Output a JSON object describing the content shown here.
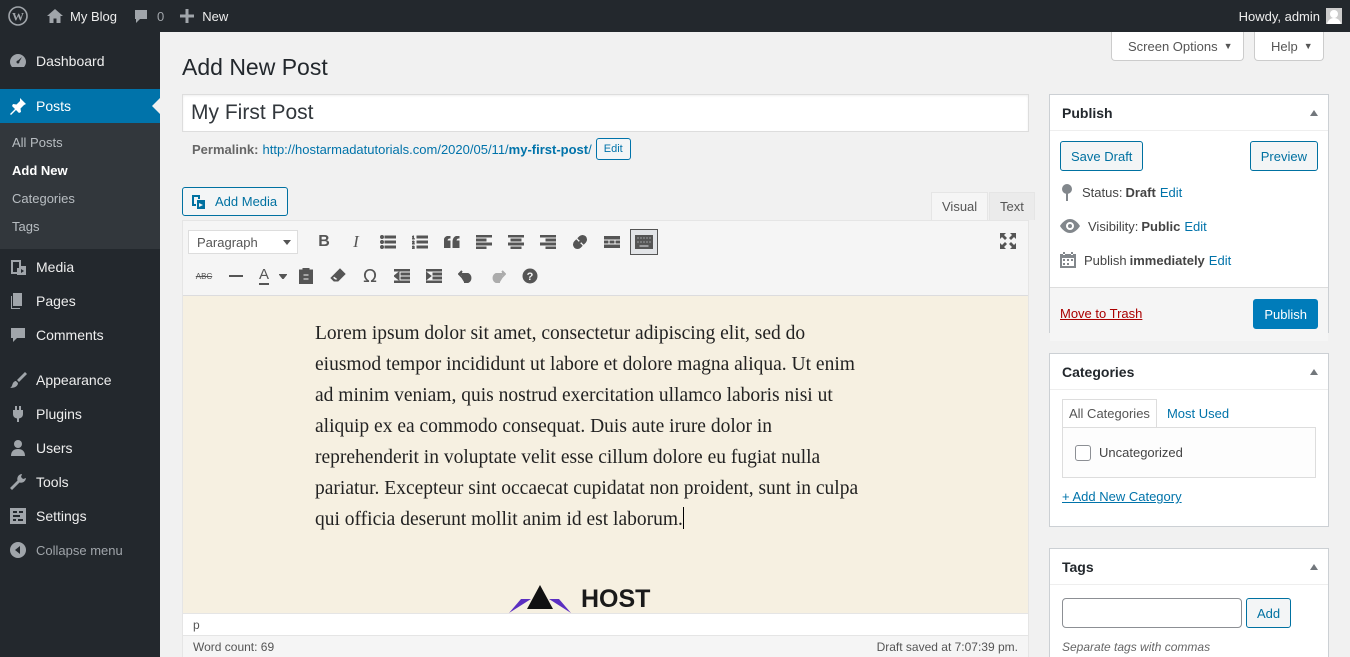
{
  "admin_bar": {
    "site_name": "My Blog",
    "comments_count": "0",
    "new_label": "New",
    "greeting": "Howdy, admin"
  },
  "menu": {
    "dashboard": "Dashboard",
    "posts": "Posts",
    "posts_sub": [
      "All Posts",
      "Add New",
      "Categories",
      "Tags"
    ],
    "media": "Media",
    "pages": "Pages",
    "comments": "Comments",
    "appearance": "Appearance",
    "plugins": "Plugins",
    "users": "Users",
    "tools": "Tools",
    "settings": "Settings",
    "collapse": "Collapse menu"
  },
  "screen_options": "Screen Options",
  "help": "Help",
  "page_title": "Add New Post",
  "post": {
    "title": "My First Post",
    "permalink_label": "Permalink:",
    "permalink_url": "http://hostarmadatutorials.com/2020/05/11/",
    "permalink_slug": "my-first-post",
    "permalink_tail": "/",
    "edit_label": "Edit"
  },
  "editor": {
    "add_media": "Add Media",
    "tab_visual": "Visual",
    "tab_text": "Text",
    "format": "Paragraph",
    "content": "Lorem ipsum dolor sit amet, consectetur adipiscing elit, sed do eiusmod tempor incididunt ut labore et dolore magna aliqua. Ut enim ad minim veniam, quis nostrud exercitation ullamco laboris nisi ut aliquip ex ea commodo consequat. Duis aute irure dolor in reprehenderit in voluptate velit esse cillum dolore eu fugiat nulla pariatur. Excepteur sint occaecat cupidatat non proident, sunt in culpa qui officia deserunt mollit anim id est laborum.",
    "logo_text": "HOST",
    "path": "p",
    "word_count": "Word count: 69",
    "draft_saved": "Draft saved at 7:07:39 pm."
  },
  "publish": {
    "title": "Publish",
    "save_draft": "Save Draft",
    "preview": "Preview",
    "status_label": "Status:",
    "status_value": "Draft",
    "visibility_label": "Visibility:",
    "visibility_value": "Public",
    "publish_label": "Publish",
    "publish_value": "immediately",
    "edit": "Edit",
    "trash": "Move to Trash",
    "publish_button": "Publish"
  },
  "categories": {
    "title": "Categories",
    "tab_all": "All Categories",
    "tab_used": "Most Used",
    "items": [
      "Uncategorized"
    ],
    "add_new": "+ Add New Category"
  },
  "tags": {
    "title": "Tags",
    "add_button": "Add",
    "hint": "Separate tags with commas"
  },
  "colors": {
    "admin_dark": "#23282d",
    "accent": "#0073aa",
    "editor_bg": "#f6f0e1",
    "logo_purple": "#5b2fc1"
  }
}
